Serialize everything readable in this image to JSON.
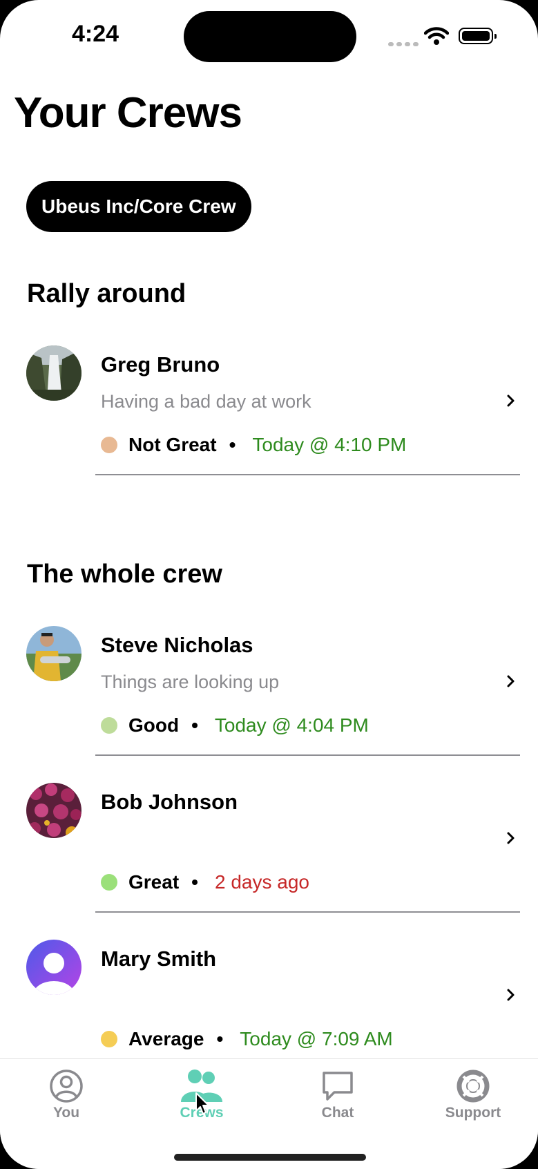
{
  "status_bar": {
    "time": "4:24"
  },
  "page_title": "Your Crews",
  "crew_selector": {
    "label": "Ubeus Inc/Core Crew"
  },
  "sections": {
    "rally": {
      "title": "Rally around",
      "members": [
        {
          "name": "Greg Bruno",
          "note": "Having a bad day at work",
          "mood": "Not Great",
          "mood_color": "#E8B993",
          "time": "Today @ 4:10 PM",
          "time_color": "#2E8B1E",
          "avatar": "waterfall-photo"
        }
      ]
    },
    "crew": {
      "title": "The whole crew",
      "members": [
        {
          "name": "Steve Nicholas",
          "note": "Things are looking up",
          "mood": "Good",
          "mood_color": "#BEDC9A",
          "time": "Today @ 4:04 PM",
          "time_color": "#2E8B1E",
          "avatar": "fishing-photo"
        },
        {
          "name": "Bob Johnson",
          "note": "",
          "mood": "Great",
          "mood_color": "#9BE07A",
          "time": "2 days ago",
          "time_color": "#C62828",
          "avatar": "flowers-photo"
        },
        {
          "name": "Mary Smith",
          "note": "",
          "mood": "Average",
          "mood_color": "#F5CD55",
          "time": "Today @ 7:09 AM",
          "time_color": "#2E8B1E",
          "avatar": "default-avatar"
        }
      ]
    }
  },
  "tab_bar": {
    "tabs": [
      {
        "label": "You",
        "icon": "person-circle-icon",
        "active": false
      },
      {
        "label": "Crews",
        "icon": "group-icon",
        "active": true
      },
      {
        "label": "Chat",
        "icon": "chat-bubble-icon",
        "active": false
      },
      {
        "label": "Support",
        "icon": "lifebuoy-icon",
        "active": false
      }
    ]
  },
  "colors": {
    "accent": "#5FCFB5",
    "inactive_tab": "#8A8A8E"
  }
}
